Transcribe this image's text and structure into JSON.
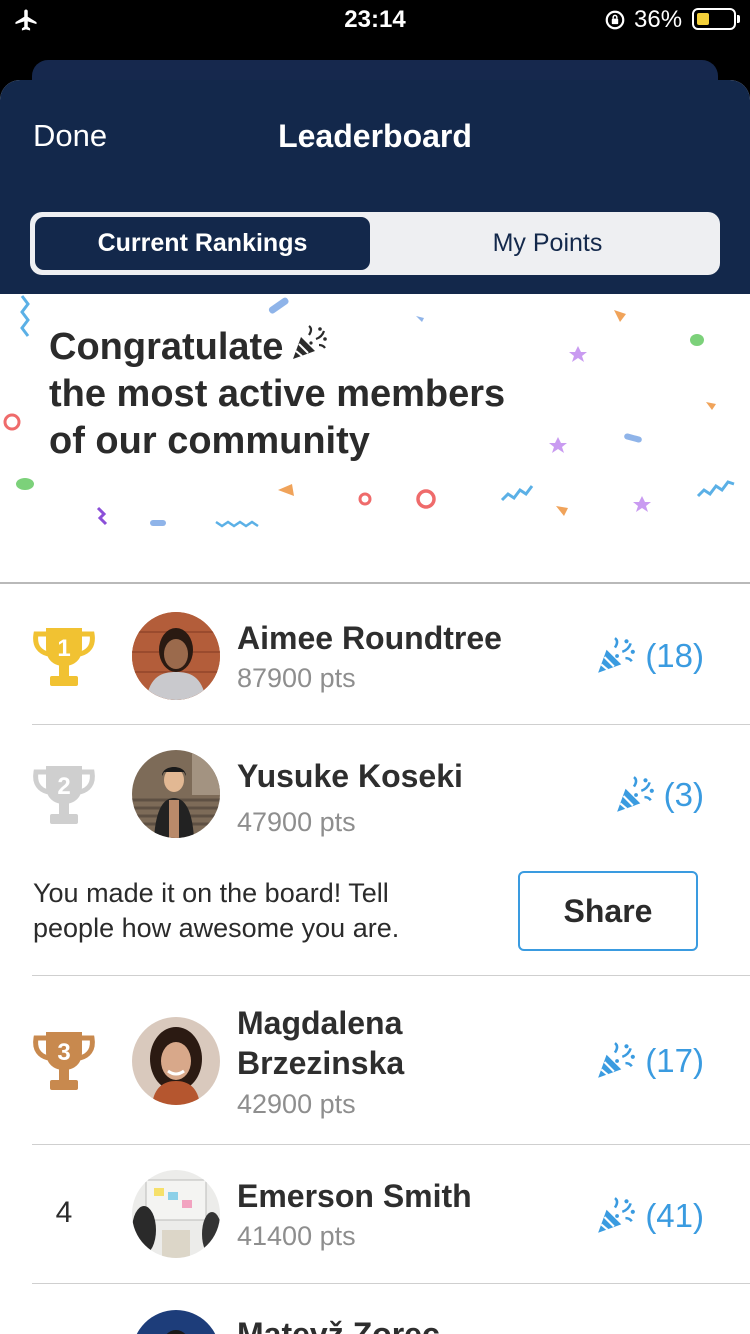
{
  "status_bar": {
    "time": "23:14",
    "battery_percent": "36%",
    "battery_level": 0.36,
    "icons": [
      "airplane-icon",
      "orientation-lock-icon",
      "battery-icon"
    ]
  },
  "header": {
    "done_label": "Done",
    "title": "Leaderboard"
  },
  "tabs": [
    {
      "label": "Current Rankings",
      "active": true
    },
    {
      "label": "My Points",
      "active": false
    }
  ],
  "banner": {
    "line1": "Congratulate",
    "line2": "the most active members",
    "line3": "of our community"
  },
  "share_prompt": {
    "text": "You made it on the board! Tell people how awesome you are.",
    "button_label": "Share"
  },
  "leaders": [
    {
      "rank": "1",
      "name": "Aimee Roundtree",
      "points": "87900 pts",
      "cheers": "(18)",
      "trophy": "gold"
    },
    {
      "rank": "2",
      "name": "Yusuke Koseki",
      "points": "47900 pts",
      "cheers": "(3)",
      "trophy": "silver"
    },
    {
      "rank": "3",
      "name": "Magdalena Brzezinska",
      "points": "42900 pts",
      "cheers": "(17)",
      "trophy": "bronze"
    },
    {
      "rank": "4",
      "name": "Emerson Smith",
      "points": "41400 pts",
      "cheers": "(41)",
      "trophy": "none"
    },
    {
      "rank": "",
      "name": "Matevž Zorec",
      "points": "",
      "cheers": "",
      "trophy": "none"
    }
  ],
  "colors": {
    "navy": "#13284b",
    "accent": "#3a9be0",
    "gold": "#f1c232",
    "silver": "#cfcfcf",
    "bronze": "#c8894e"
  }
}
